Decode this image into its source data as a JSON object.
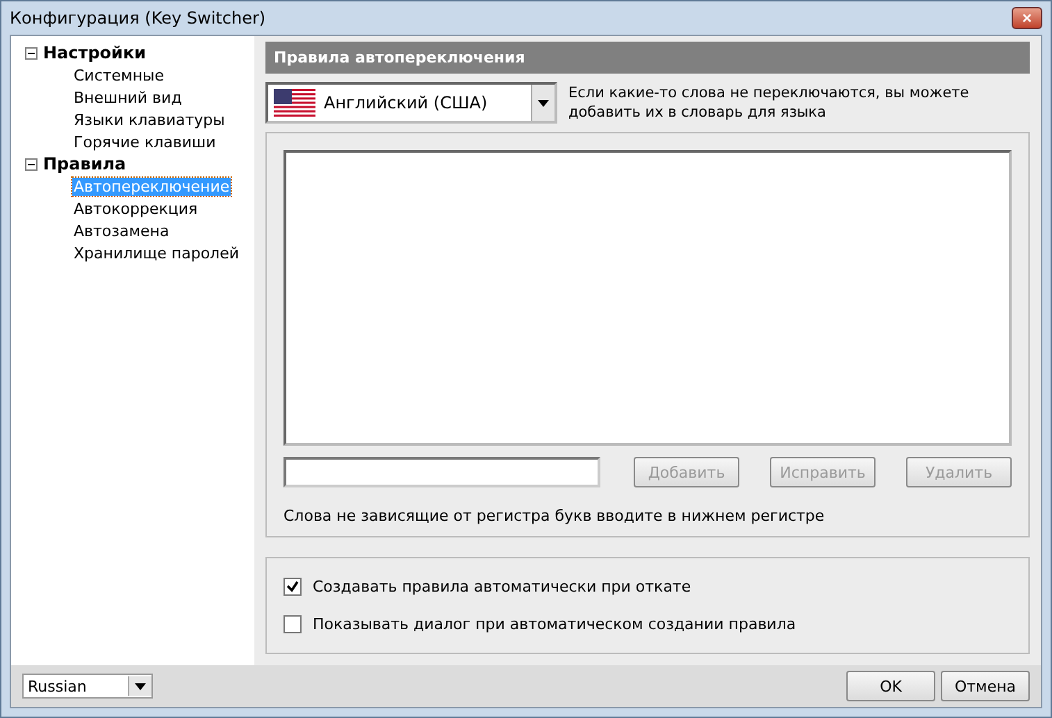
{
  "window": {
    "title": "Конфигурация (Key Switcher)",
    "close": "×"
  },
  "tree": [
    {
      "label": "Настройки",
      "expanded": true,
      "children": [
        {
          "label": "Системные",
          "selected": false
        },
        {
          "label": "Внешний вид",
          "selected": false
        },
        {
          "label": "Языки клавиатуры",
          "selected": false
        },
        {
          "label": "Горячие клавиши",
          "selected": false
        }
      ]
    },
    {
      "label": "Правила",
      "expanded": true,
      "children": [
        {
          "label": "Автопереключение",
          "selected": true
        },
        {
          "label": "Автокоррекция",
          "selected": false
        },
        {
          "label": "Автозамена",
          "selected": false
        },
        {
          "label": "Хранилище паролей",
          "selected": false
        }
      ]
    }
  ],
  "panel": {
    "title": "Правила автопереключения",
    "language": "Английский (США)",
    "hint": "Если какие-то слова не переключаются, вы можете добавить их в словарь для языка",
    "buttons": [
      {
        "label": "Добавить",
        "disabled": true
      },
      {
        "label": "Исправить",
        "disabled": true
      },
      {
        "label": "Удалить",
        "disabled": true
      }
    ],
    "note": "Слова не зависящие от регистра букв вводите в нижнем регистре",
    "options": [
      {
        "label": "Создавать правила автоматически при откате",
        "checked": true
      },
      {
        "label": "Показывать диалог при автоматическом создании правила",
        "checked": false
      }
    ]
  },
  "footer": {
    "language": "Russian",
    "buttons": [
      "OK",
      "Отмена"
    ]
  }
}
